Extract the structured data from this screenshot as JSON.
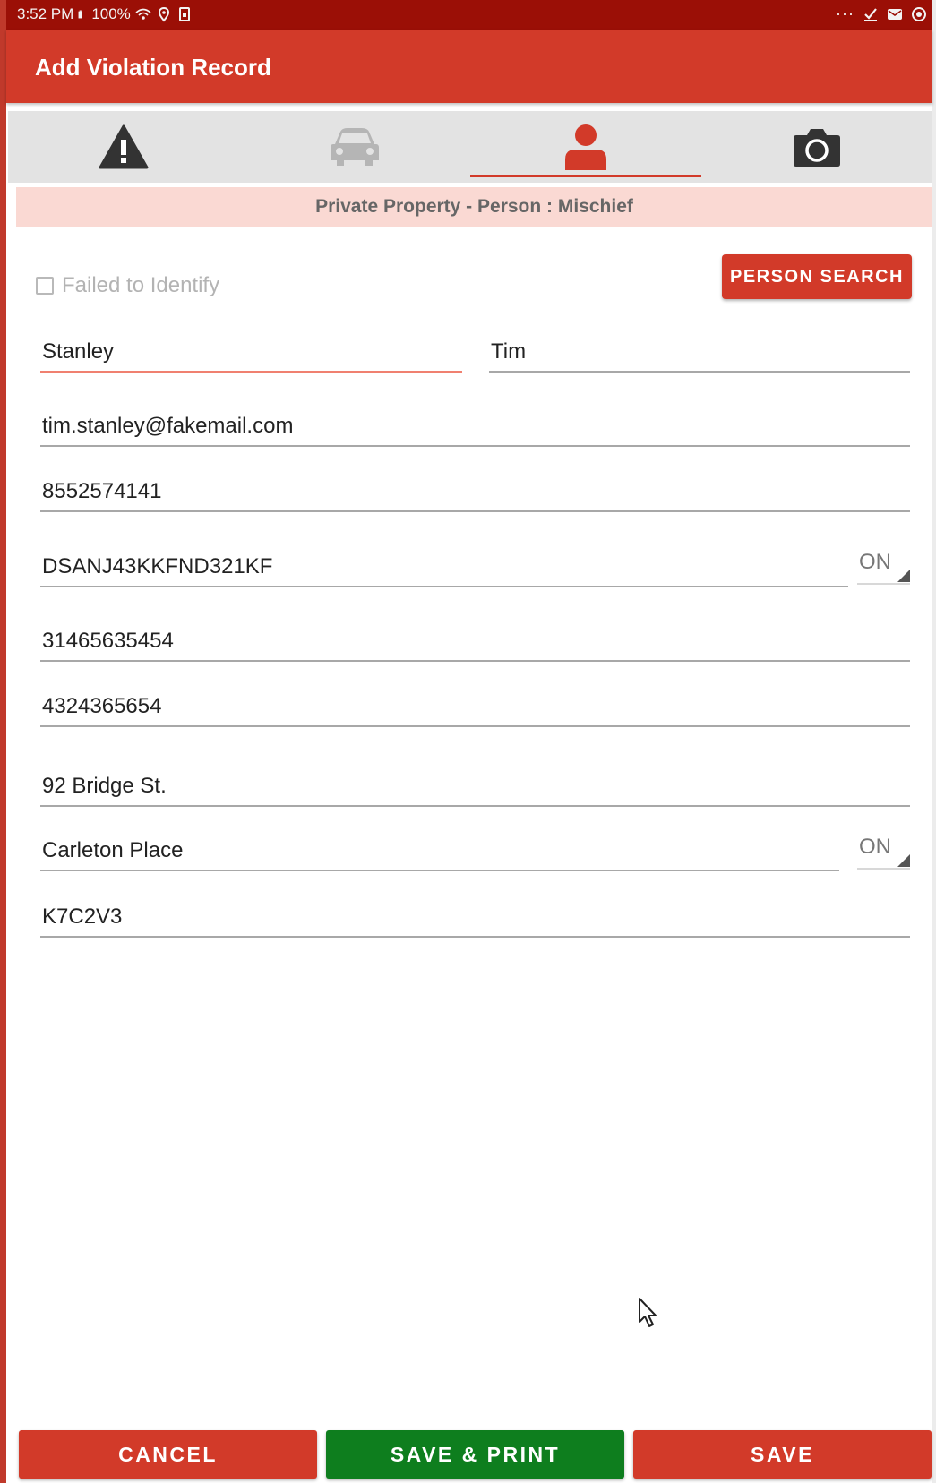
{
  "status_bar": {
    "time": "3:52 PM",
    "battery": "100%",
    "overflow": "···"
  },
  "app_bar": {
    "title": "Add Violation Record"
  },
  "tabs": [
    {
      "name": "violation",
      "icon": "warning-icon",
      "active": false
    },
    {
      "name": "vehicle",
      "icon": "car-icon",
      "active": false,
      "disabled": true
    },
    {
      "name": "person",
      "icon": "person-icon",
      "active": true
    },
    {
      "name": "photo",
      "icon": "camera-icon",
      "active": false
    }
  ],
  "banner": {
    "text": "Private Property - Person : Mischief"
  },
  "form": {
    "failed_to_identify": {
      "label": "Failed to Identify",
      "checked": false
    },
    "person_search_label": "PERSON SEARCH",
    "last_name": "Stanley",
    "first_name": "Tim",
    "email": "tim.stanley@fakemail.com",
    "phone": "8552574141",
    "license_number": "DSANJ43KKFND321KF",
    "license_province": "ON",
    "field_5": "31465635454",
    "field_6": "4324365654",
    "address": "92 Bridge St.",
    "city": "Carleton Place",
    "province": "ON",
    "postal_code": "K7C2V3"
  },
  "buttons": {
    "cancel": "CANCEL",
    "save_print": "SAVE & PRINT",
    "save": "SAVE"
  },
  "colors": {
    "primary": "#d23a29",
    "status_bar": "#9b0f06",
    "banner_bg": "#fad9d3",
    "green": "#0e7e1e"
  }
}
